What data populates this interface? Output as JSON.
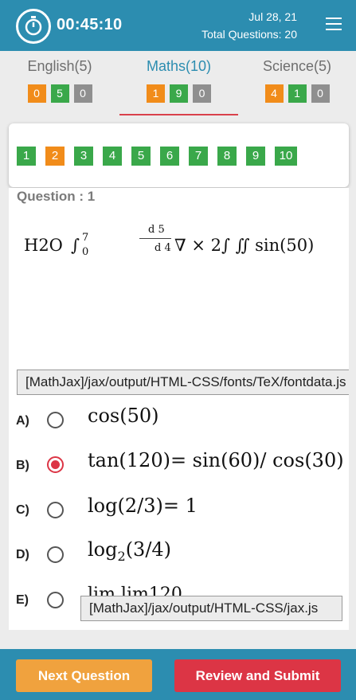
{
  "header": {
    "timer": "00:45:10",
    "date": "Jul 28, 21",
    "total_questions": "Total Questions: 20"
  },
  "subjects": [
    {
      "label": "English(5)",
      "counts": [
        "0",
        "5",
        "0"
      ],
      "active": false
    },
    {
      "label": "Maths(10)",
      "counts": [
        "1",
        "9",
        "0"
      ],
      "active": true
    },
    {
      "label": "Science(5)",
      "counts": [
        "4",
        "1",
        "0"
      ],
      "active": false
    }
  ],
  "question_nav": [
    "1",
    "2",
    "3",
    "4",
    "5",
    "6",
    "7",
    "8",
    "9",
    "10"
  ],
  "question": {
    "title": "Question : 1",
    "h2o": "H2O",
    "integral": "∫",
    "int_upper": "7",
    "int_lower": "0",
    "frac_num": "d 5",
    "frac_den": "d 4",
    "expr_rest": "∇ × 2∫ ∬ sin(50)",
    "error_1": "[MathJax]/jax/output/HTML-CSS/fonts/TeX/fontdata.js"
  },
  "options": [
    {
      "letter": "A)",
      "text": "cos(50)",
      "checked": false
    },
    {
      "letter": "B)",
      "text": "tan(120)= sin(60)/ cos(30)",
      "checked": true
    },
    {
      "letter": "C)",
      "text": "log(2/3)= 1",
      "checked": false
    },
    {
      "letter": "D)",
      "text_main": "log",
      "text_sub": "2",
      "text_rest": "(3/4)",
      "checked": false
    },
    {
      "letter": "E)",
      "text": "lim    lim120",
      "checked": false
    }
  ],
  "error_2": "[MathJax]/jax/output/HTML-CSS/jax.js",
  "buttons": {
    "next": "Next Question",
    "review": "Review and Submit"
  },
  "colors": {
    "primary": "#2c8db0",
    "orange": "#f18c1a",
    "green": "#3aa84a",
    "gray": "#8f8f8f",
    "red": "#dc3545",
    "next_button": "#f0a23e"
  }
}
